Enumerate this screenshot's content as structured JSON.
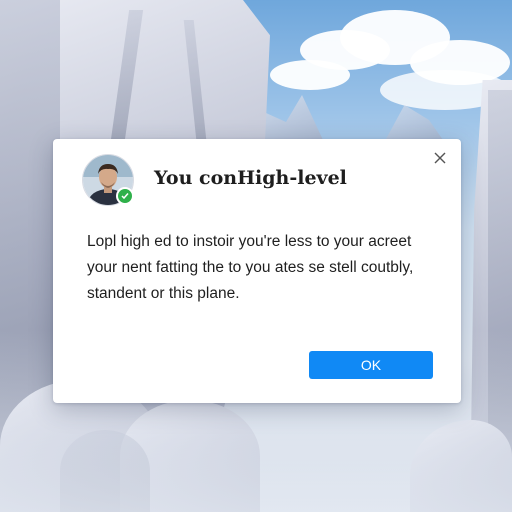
{
  "dialog": {
    "title": "You conHigh-level",
    "message_lines": [
      "Lopl high ed to instoir you're less to your acreet",
      "your nent fatting the to you ates se stell coutbly,",
      "standent or this plane."
    ],
    "ok_label": "OK",
    "close_icon": "close-icon",
    "avatar_badge_icon": "checkmark-icon"
  },
  "colors": {
    "accent": "#1089f5",
    "badge": "#2fb04a",
    "dialog_bg": "#ffffff",
    "text": "#1f1f1f"
  }
}
